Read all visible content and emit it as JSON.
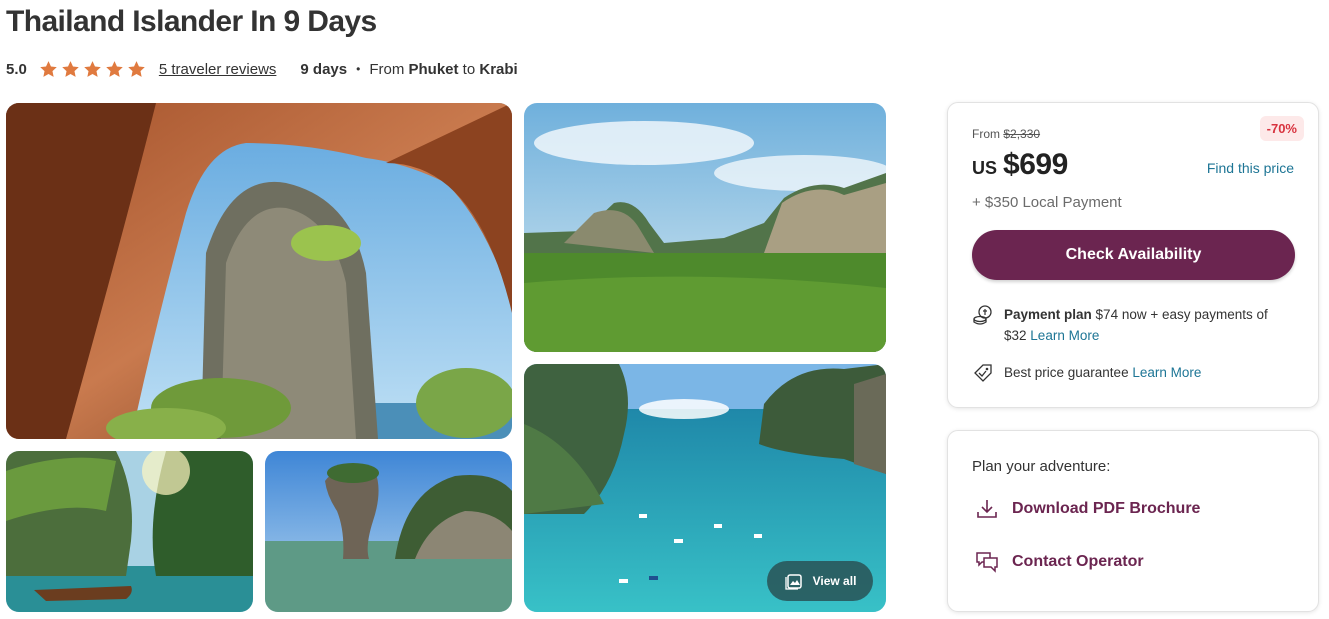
{
  "tour": {
    "title": "Thailand Islander In 9 Days",
    "rating": "5.0",
    "stars": 5,
    "reviews_label": "5 traveler reviews",
    "duration": "9 days",
    "route_from_label": "From",
    "route_start": "Phuket",
    "route_to_label": "to",
    "route_end": "Krabi"
  },
  "gallery": {
    "photos": [
      "cave-arch-island-view",
      "green-valley-karst-hills",
      "longtail-boat-cliffs",
      "james-bond-island",
      "turquoise-bay-aerial"
    ],
    "view_all_label": "View all"
  },
  "pricing": {
    "from_label": "From",
    "original_price": "$2,330",
    "discount_badge": "-70%",
    "currency": "US",
    "price": "$699",
    "find_price_label": "Find this price",
    "local_payment": "+ $350 Local Payment",
    "cta_label": "Check Availability",
    "payment_plan_title": "Payment plan",
    "payment_plan_text": "$74 now + easy payments of $32",
    "payment_learn_more": "Learn More",
    "best_price_text": "Best price guarantee",
    "best_price_learn_more": "Learn More"
  },
  "plan": {
    "title": "Plan your adventure:",
    "download_label": "Download PDF Brochure",
    "contact_label": "Contact Operator"
  },
  "colors": {
    "accent": "#6b2550",
    "link": "#1d7595",
    "star": "#e07a3f",
    "discount": "#d8333f"
  }
}
